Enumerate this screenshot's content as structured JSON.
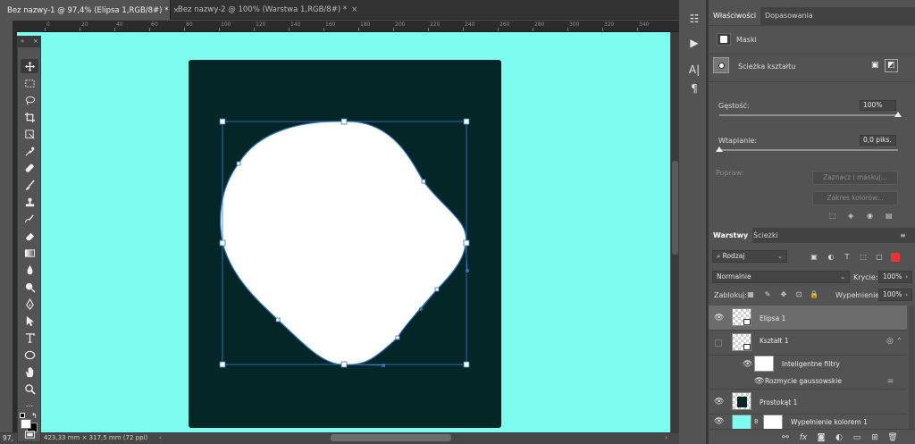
{
  "doc_tabs": [
    {
      "label": "Bez nazwy-1 @ 97,4% (Elipsa 1,RGB/8#) *",
      "close": "×"
    },
    {
      "label": "Bez nazwy-2 @ 100% (Warstwa 1,RGB/8#) *",
      "close": "×"
    }
  ],
  "ruler": {
    "ticks": [
      "0",
      "20",
      "40",
      "60",
      "80",
      "100",
      "120",
      "140",
      "160",
      "180",
      "200",
      "220",
      "240",
      "260",
      "280",
      "300",
      "320",
      "340"
    ]
  },
  "toolbar": {
    "collapse": "»",
    "close": "×",
    "more": "..."
  },
  "status": {
    "zoom": "97,",
    "dimensions": "423,33 mm × 317,5 mm (72 ppi)",
    "arrow_left": "‹",
    "arrow_right": "›"
  },
  "iconstrip": {
    "history": "☷",
    "play": "▶",
    "char": "A|",
    "para": "¶"
  },
  "properties": {
    "tab_active": "Właściwości",
    "tab_other": "Dopasowania",
    "masks_label": "Maski",
    "path_label": "Ścieżka kształtu",
    "density_label": "Gęstość:",
    "density_value": "100%",
    "feather_label": "Wtapianie:",
    "feather_value": "0,0 piks.",
    "refine_label": "Popraw:",
    "select_mask_button": "Zaznacz i maskuj...",
    "color_range_button": "Zakres kolorów...",
    "density": 1.0,
    "feather": 0.0
  },
  "layers": {
    "tab_active": "Warstwy",
    "tab_other": "Ścieżki",
    "filter_kind": "Rodzaj",
    "blend_mode": "Normalnie",
    "opacity_label": "Krycie:",
    "opacity_value": "100%",
    "lock_label": "Zablokuj:",
    "fill_label": "Wypełnienie:",
    "fill_value": "100%",
    "items": [
      {
        "name": "Elipsa 1"
      },
      {
        "name": "Kształt 1"
      },
      {
        "name": "Inteligentne filtry"
      },
      {
        "name": "Rozmycie gaussowskie"
      },
      {
        "name": "Prostokąt 1"
      },
      {
        "name": "Wypełnienie kolorem 1"
      }
    ]
  },
  "colors": {
    "canvas": "#7dfdf0",
    "artboard": "#052626",
    "shape_fill": "#ffffff",
    "path_stroke": "#2f74c0",
    "panel_bg": "#535353"
  }
}
